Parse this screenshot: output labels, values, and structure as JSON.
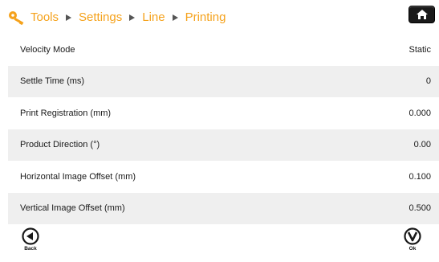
{
  "header": {
    "breadcrumb": [
      "Tools",
      "Settings",
      "Line",
      "Printing"
    ]
  },
  "settings": [
    {
      "label": "Velocity Mode",
      "value": "Static"
    },
    {
      "label": "Settle Time (ms)",
      "value": "0"
    },
    {
      "label": "Print Registration (mm)",
      "value": "0.000"
    },
    {
      "label": "Product Direction (°)",
      "value": "0.00"
    },
    {
      "label": "Horizontal Image Offset (mm)",
      "value": "0.100"
    },
    {
      "label": "Vertical Image Offset (mm)",
      "value": "0.500"
    }
  ],
  "footer": {
    "back_label": "Back",
    "ok_label": "Ok"
  },
  "colors": {
    "breadcrumb": "#f5a21c",
    "row_alt": "#efefef",
    "home_button": "#1a1a1a"
  },
  "icons": [
    "keys-icon",
    "home-icon",
    "back-icon",
    "ok-icon"
  ]
}
